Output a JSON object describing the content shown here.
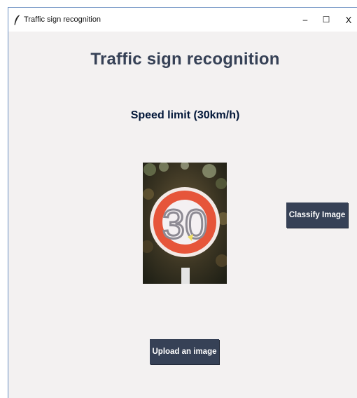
{
  "window": {
    "title": "Traffic sign recognition",
    "icon": "feather-icon",
    "controls": {
      "minimize": "–",
      "maximize": "☐",
      "close": "X"
    }
  },
  "main": {
    "heading": "Traffic sign recognition",
    "result": "Speed limit (30km/h)",
    "image": {
      "sign_text": "30"
    },
    "classify_label": "Classify Image",
    "upload_label": "Upload an image"
  },
  "colors": {
    "background": "#f3f1f1",
    "heading": "#364156",
    "result": "#011638",
    "button_bg": "#364156",
    "button_fg": "#ffffff",
    "sign_ring": "#e6553a"
  }
}
